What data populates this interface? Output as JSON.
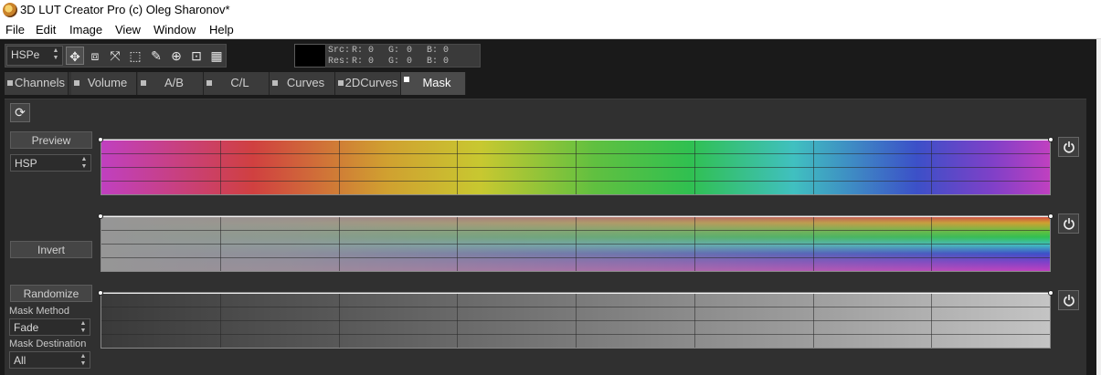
{
  "window": {
    "title": "3D LUT Creator Pro (c) Oleg Sharonov*"
  },
  "menu": [
    "File",
    "Edit",
    "Image",
    "View",
    "Window",
    "Help"
  ],
  "toolbar": {
    "color_model": "HSPe",
    "tools": [
      "move-icon",
      "transform-icon",
      "collapse-icon",
      "select-rect-icon",
      "eyedropper-add-icon",
      "zoom-icon",
      "fit-icon",
      "grid-icon"
    ]
  },
  "readout": {
    "src_label": "Src:",
    "res_label": "Res:",
    "r": "R:",
    "g": "G:",
    "b": "B:",
    "src": {
      "r": "0",
      "g": "0",
      "b": "0"
    },
    "res": {
      "r": "0",
      "g": "0",
      "b": "0"
    }
  },
  "tabs": [
    {
      "label": "Channels",
      "active": false
    },
    {
      "label": "Volume",
      "active": false
    },
    {
      "label": "A/B",
      "active": false
    },
    {
      "label": "C/L",
      "active": false
    },
    {
      "label": "Curves",
      "active": false
    },
    {
      "label": "2DCurves",
      "active": false
    },
    {
      "label": "Mask",
      "active": true
    }
  ],
  "mask_panel": {
    "preview_label": "Preview",
    "mode_value": "HSP",
    "invert_label": "Invert",
    "randomize_label": "Randomize",
    "mask_method_label": "Mask Method",
    "mask_method_value": "Fade",
    "mask_destination_label": "Mask Destination",
    "mask_destination_value": "All"
  },
  "colors": {
    "frame": "#1a1a1a",
    "panel": "#303030",
    "hue_stops": [
      "#c040c0",
      "#d04040",
      "#d0a030",
      "#c8c830",
      "#60c040",
      "#30c050",
      "#40c0c0",
      "#3c50c8",
      "#8040c8",
      "#c040c0"
    ]
  }
}
